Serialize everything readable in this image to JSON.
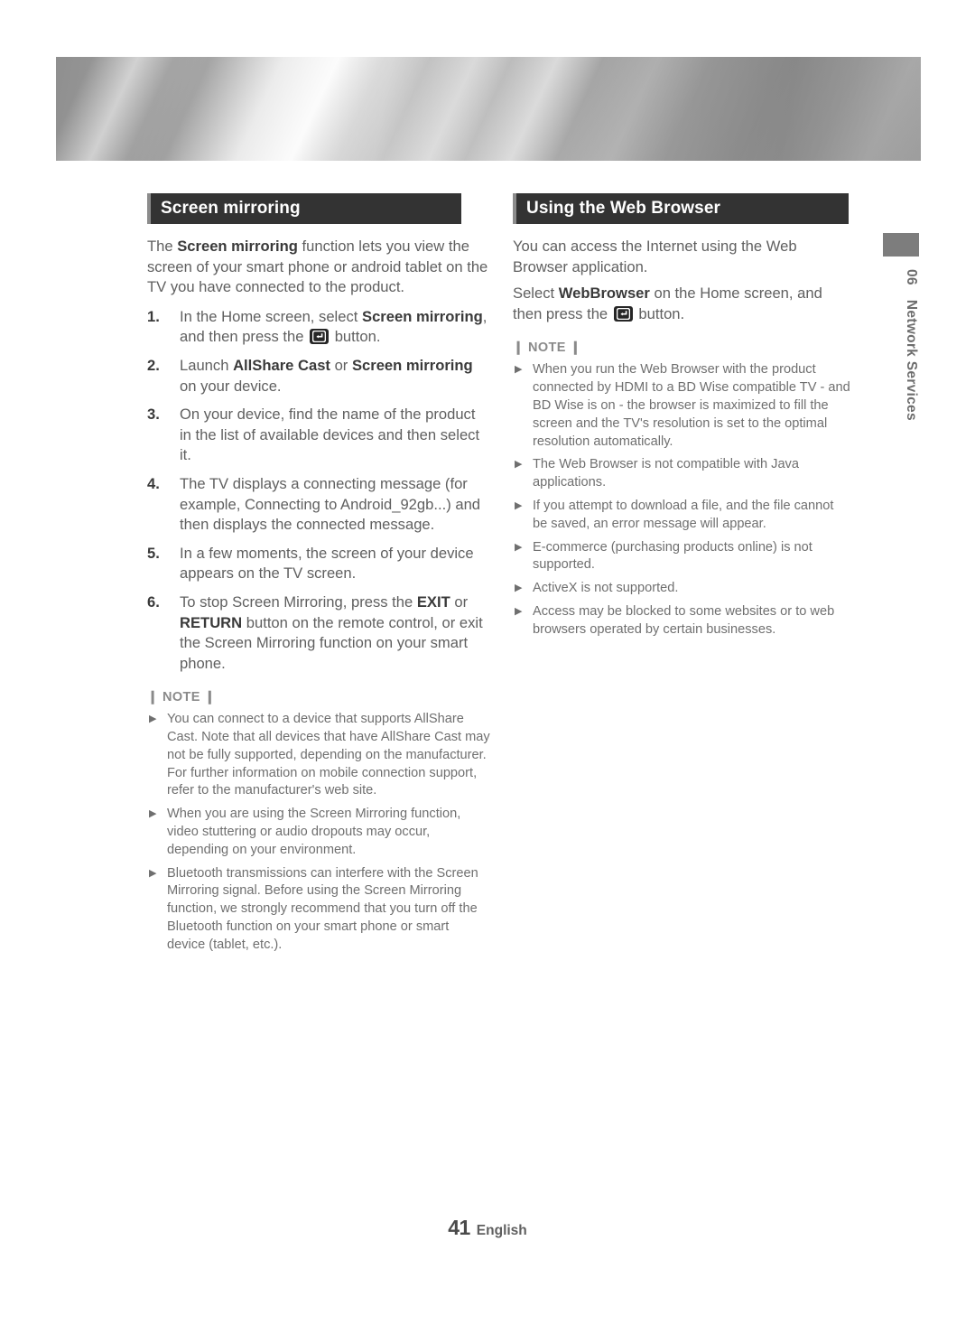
{
  "page": {
    "number": "41",
    "language": "English",
    "banner_style": "brushed-metal-gradient"
  },
  "side_tab": {
    "chapter_number": "06",
    "chapter_title": "Network Services"
  },
  "left_column": {
    "section_title": "Screen mirroring",
    "intro": {
      "part1": "The ",
      "bold1": "Screen mirroring",
      "part2": " function lets you view the screen of your smart phone or android tablet on the TV you have connected to the product."
    },
    "steps": [
      {
        "num": "1.",
        "part1": "In the Home screen, select ",
        "bold1": "Screen mirroring",
        "part2": ", and then press the ",
        "icon": "enter-button-icon",
        "part3": " button."
      },
      {
        "num": "2.",
        "part1": "Launch ",
        "bold1": "AllShare Cast",
        "part2": " or ",
        "bold2": "Screen mirroring",
        "part3": " on your device."
      },
      {
        "num": "3.",
        "part1": "On your device, find the name of the product in the list of available devices and then select it."
      },
      {
        "num": "4.",
        "part1": "The TV displays a connecting message (for example, Connecting to Android_92gb...) and then displays the connected message."
      },
      {
        "num": "5.",
        "part1": "In a few moments, the screen of your device appears on the TV screen."
      },
      {
        "num": "6.",
        "part1": "To stop Screen Mirroring, press the ",
        "bold1": "EXIT",
        "part2": " or ",
        "bold2": "RETURN",
        "part3": " button on the remote control, or exit the Screen Mirroring function on your smart phone."
      }
    ],
    "note_label": "❙ NOTE ❙",
    "notes": [
      "You can connect to a device that supports AllShare Cast. Note that all devices that have AllShare Cast may not be fully supported, depending on the manufacturer. For further information on mobile connection support, refer to the manufacturer's web site.",
      "When you are using the Screen Mirroring function, video stuttering or audio dropouts may occur, depending on your environment.",
      "Bluetooth transmissions can interfere with the Screen Mirroring signal. Before using the Screen Mirroring function, we strongly recommend that you turn off the Bluetooth function on your smart phone or smart device (tablet, etc.)."
    ]
  },
  "right_column": {
    "section_title": "Using the Web Browser",
    "intro": "You can access the Internet using the Web Browser application.",
    "select_line": {
      "part1": "Select ",
      "bold1": "WebBrowser",
      "part2": " on the Home screen, and then press the ",
      "icon": "enter-button-icon",
      "part3": " button."
    },
    "note_label": "❙ NOTE ❙",
    "notes": [
      "When you run the Web Browser with the product connected by HDMI to a BD Wise compatible TV - and BD Wise is on - the browser is maximized to fill the screen and the TV's resolution is set to the optimal resolution automatically.",
      "The Web Browser is not compatible with Java applications.",
      "If you attempt to download a file, and the file cannot be saved, an error message will appear.",
      "E-commerce (purchasing products online) is not supported.",
      "ActiveX is not supported.",
      "Access may be blocked to some websites or to web browsers operated by certain businesses."
    ]
  },
  "colors": {
    "section_bar_bg": "#333333",
    "section_bar_accent": "#8c8c8c",
    "body_text": "#5f5f5f",
    "bold_text": "#3a3a3a",
    "note_text": "#6f6f6f",
    "side_tab_block": "#7d7d7d"
  }
}
